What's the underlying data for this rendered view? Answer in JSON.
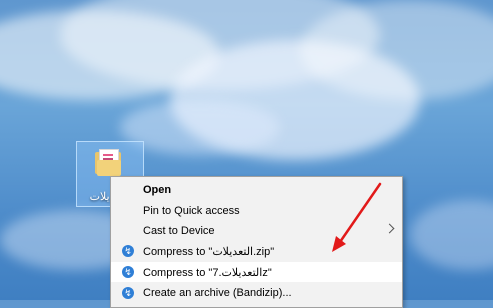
{
  "desktop": {
    "folder_label": "التعديلات"
  },
  "context_menu": {
    "items": [
      {
        "label": "Open"
      },
      {
        "label": "Pin to Quick access"
      },
      {
        "label": "Cast to Device"
      },
      {
        "label": "Compress to \"التعديلات.zip\""
      },
      {
        "label": "Compress to \"التعديلات.7z\""
      },
      {
        "label": "Create an archive (Bandizip)..."
      }
    ]
  },
  "icons": {
    "folder": "folder-icon",
    "bandizip": "bandizip-icon",
    "submenu": "chevron-right-icon",
    "annotation": "red-arrow-icon"
  },
  "colors": {
    "menu_background": "#f2f2f2",
    "menu_highlight": "#ffffff",
    "bandizip_blue": "#2f7fd6",
    "annotation_red": "#e21a1a",
    "selection_blue": "#99ccff"
  }
}
